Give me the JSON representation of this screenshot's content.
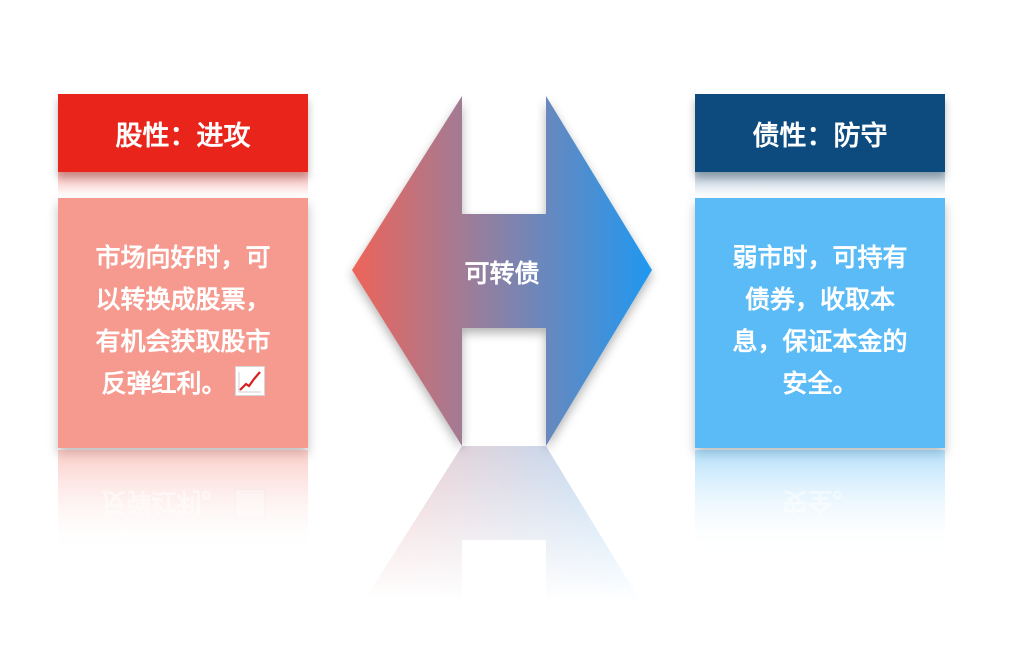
{
  "left": {
    "header": "股性：进攻",
    "lines": [
      "市场向好时，可",
      "以转换成股票，",
      "有机会获取股市",
      "反弹红利。"
    ],
    "icon": "chart-increasing-icon",
    "header_color": "#e8241b",
    "body_color": "#f69a90"
  },
  "center": {
    "label": "可转债",
    "gradient_start": "#ee6459",
    "gradient_end": "#1f98f1"
  },
  "right": {
    "header": "债性：防守",
    "lines": [
      "弱市时，可持有",
      "债券，收取本",
      "息，保证本金的",
      "安全。"
    ],
    "header_color": "#0d4a7e",
    "body_color": "#5abbf7"
  }
}
